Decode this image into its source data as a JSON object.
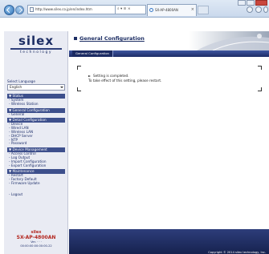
{
  "browser": {
    "address": "http://www.silex.co.jp/en/index.htm",
    "address_controls": "⌕ ▾ ≡ ×",
    "tab_title": "SX-AP-4800AN",
    "tab_close": "×"
  },
  "sidebar": {
    "logo_word": "silex",
    "logo_sub": "technology",
    "language_label": "Select Language",
    "language_value": "English",
    "groups": [
      {
        "title": "▼ Status",
        "items": [
          "- System",
          "- Wireless Station"
        ]
      },
      {
        "title": "▼ General Configuration",
        "items": [
          "- General"
        ]
      },
      {
        "title": "▼ Detail Configuration",
        "items": [
          "- Device",
          "- Wired LAN",
          "- Wireless LAN",
          "- DHCP Server",
          "- NTP",
          "- Password"
        ]
      },
      {
        "title": "▼ Device Management",
        "items": [
          "- Access Control",
          "- Log Output",
          "- Import Configuration",
          "- Export Configuration"
        ]
      },
      {
        "title": "▼ Maintenance",
        "items": [
          "- Restart",
          "- Factory Default",
          "- Firmware Update"
        ]
      }
    ],
    "logout": "- Logout",
    "model_brand": "silex",
    "model_name": "SX-AP-4800AN",
    "model_version": "Ver. · · ·",
    "model_id": "00:00:00:00:00:00-22"
  },
  "main": {
    "page_title": "General Configuration",
    "tab_label": "General Configuration",
    "message_line1": "Setting is completed.",
    "message_line2": "To take effect of this setting, please restart.",
    "footer_copyright": "Copyright © 2014 silex technology, Inc."
  },
  "colors": {
    "navy": "#1c2d63",
    "model_red": "#b3261e",
    "menu_header": "#3d4f8c"
  }
}
